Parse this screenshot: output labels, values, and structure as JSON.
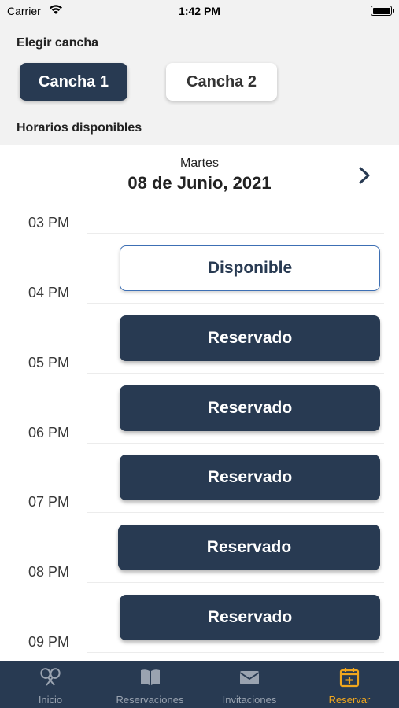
{
  "status_bar": {
    "carrier": "Carrier",
    "time": "1:42 PM"
  },
  "court_selection": {
    "label": "Elegir cancha",
    "courts": [
      {
        "label": "Cancha 1",
        "selected": true
      },
      {
        "label": "Cancha 2",
        "selected": false
      }
    ]
  },
  "schedule_label": "Horarios disponibles",
  "date": {
    "weekday": "Martes",
    "full": "08 de Junio, 2021"
  },
  "times": [
    "03 PM",
    "04 PM",
    "05 PM",
    "06 PM",
    "07 PM",
    "08 PM",
    "09 PM"
  ],
  "slots": [
    {
      "label": "Disponible",
      "status": "available"
    },
    {
      "label": "Reservado",
      "status": "booked"
    },
    {
      "label": "Reservado",
      "status": "booked"
    },
    {
      "label": "Reservado",
      "status": "booked"
    },
    {
      "label": "Reservado",
      "status": "booked"
    },
    {
      "label": "Reservado",
      "status": "booked"
    }
  ],
  "tab_bar": {
    "items": [
      {
        "label": "Inicio",
        "icon": "racket-icon",
        "active": false
      },
      {
        "label": "Reservaciones",
        "icon": "book-icon",
        "active": false
      },
      {
        "label": "Invitaciones",
        "icon": "envelope-icon",
        "active": false
      },
      {
        "label": "Reservar",
        "icon": "calendar-add-icon",
        "active": true
      }
    ]
  },
  "colors": {
    "primary": "#283a52",
    "active_tab": "#f0a61e",
    "inactive_tab": "#9aa3b0",
    "available_border": "#3d6fb4",
    "header_bg": "#f2f2f2"
  }
}
